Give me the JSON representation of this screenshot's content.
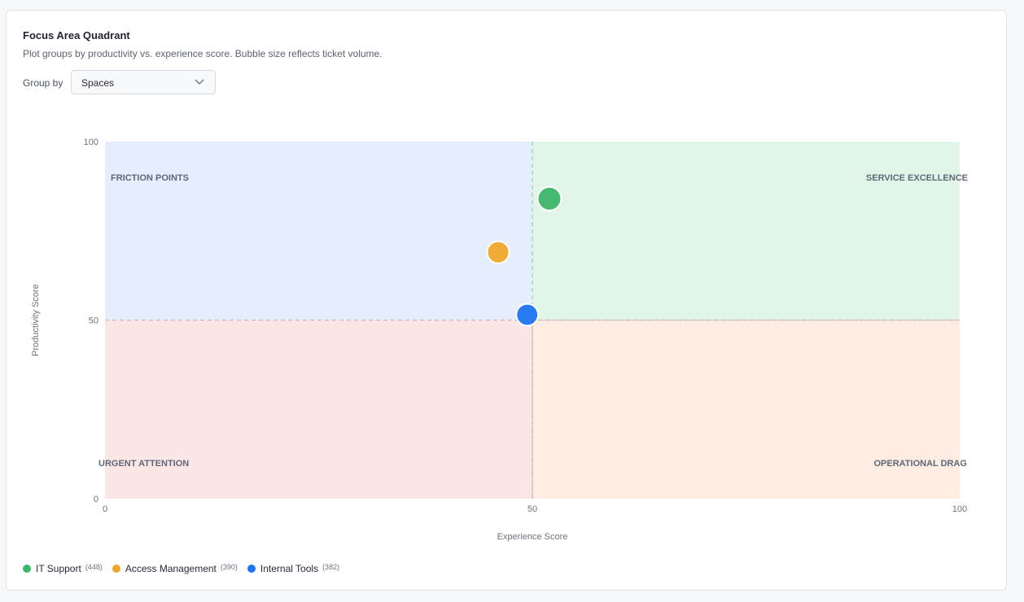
{
  "header": {
    "title": "Focus Area Quadrant",
    "subtitle": "Plot groups by productivity vs. experience score. Bubble size reflects ticket volume."
  },
  "controls": {
    "group_by_label": "Group by",
    "group_by_value": "Spaces",
    "chevron_icon": "chevron-down-icon"
  },
  "chart_data": {
    "type": "scatter",
    "xlabel": "Experience Score",
    "ylabel": "Productivity Score",
    "xlim": [
      0,
      100
    ],
    "ylim": [
      0,
      100
    ],
    "x_ticks": [
      "0",
      "50",
      "100"
    ],
    "y_ticks": [
      "0",
      "50",
      "100"
    ],
    "threshold_x": 50,
    "threshold_y": 50,
    "quadrants": [
      {
        "label": "FRICTION POINTS",
        "position": "top-left",
        "color": "#e4eefc"
      },
      {
        "label": "SERVICE EXCELLENCE",
        "position": "top-right",
        "color": "#e2f5e9"
      },
      {
        "label": "URGENT ATTENTION",
        "position": "bottom-left",
        "color": "#fbe6e6"
      },
      {
        "label": "OPERATIONAL DRAG",
        "position": "bottom-right",
        "color": "#fdece2"
      }
    ],
    "series": [
      {
        "name": "IT Support",
        "count": "(448)",
        "x": 52,
        "y": 84,
        "volume": 448,
        "color": "#3db56a"
      },
      {
        "name": "Access Management",
        "count": "(390)",
        "x": 46,
        "y": 69,
        "volume": 390,
        "color": "#f0a62c"
      },
      {
        "name": "Internal Tools",
        "count": "(382)",
        "x": 49.4,
        "y": 51.5,
        "volume": 382,
        "color": "#1f74f2"
      }
    ]
  }
}
